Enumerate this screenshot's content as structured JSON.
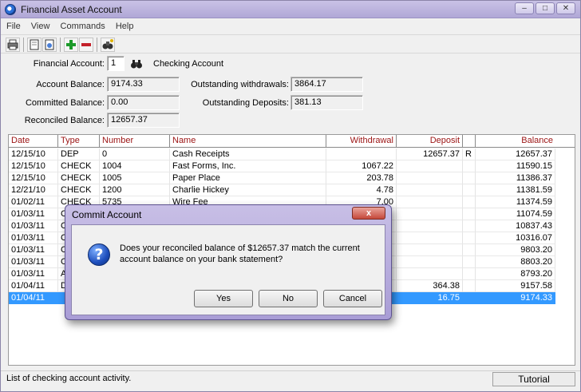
{
  "window": {
    "title": "Financial Asset Account"
  },
  "menu": [
    "File",
    "View",
    "Commands",
    "Help"
  ],
  "toolbar": {
    "icons": [
      "print-icon",
      "open-icon",
      "doc-icon",
      "add-icon",
      "remove-icon",
      "find-icon"
    ]
  },
  "account": {
    "financial_account_label": "Financial Account:",
    "financial_account_value": "1",
    "account_name": "Checking Account",
    "account_balance_label": "Account Balance:",
    "account_balance_value": "9174.33",
    "committed_balance_label": "Committed Balance:",
    "committed_balance_value": "0.00",
    "reconciled_balance_label": "Reconciled Balance:",
    "reconciled_balance_value": "12657.37",
    "outstanding_withdrawals_label": "Outstanding withdrawals:",
    "outstanding_withdrawals_value": "3864.17",
    "outstanding_deposits_label": "Outstanding Deposits:",
    "outstanding_deposits_value": "381.13"
  },
  "grid": {
    "columns": [
      "Date",
      "Type",
      "Number",
      "Name",
      "Withdrawal",
      "Deposit",
      "",
      "Balance"
    ],
    "rows": [
      [
        "12/15/10",
        "DEP",
        "0",
        "Cash Receipts",
        "",
        "12657.37",
        "R",
        "12657.37"
      ],
      [
        "12/15/10",
        "CHECK",
        "1004",
        "Fast Forms, Inc.",
        "1067.22",
        "",
        "",
        "11590.15"
      ],
      [
        "12/15/10",
        "CHECK",
        "1005",
        "Paper Place",
        "203.78",
        "",
        "",
        "11386.37"
      ],
      [
        "12/21/10",
        "CHECK",
        "1200",
        "Charlie Hickey",
        "4.78",
        "",
        "",
        "11381.59"
      ],
      [
        "01/02/11",
        "CHECK",
        "5735",
        "Wire Fee",
        "7.00",
        "",
        "",
        "11374.59"
      ],
      [
        "01/03/11",
        "C",
        "",
        "",
        "",
        "",
        "",
        "11074.59"
      ],
      [
        "01/03/11",
        "C",
        "",
        "",
        "",
        "",
        "",
        "10837.43"
      ],
      [
        "01/03/11",
        "C",
        "",
        "",
        "",
        "",
        "",
        "10316.07"
      ],
      [
        "01/03/11",
        "C",
        "",
        "",
        "",
        "",
        "",
        "9803.20"
      ],
      [
        "01/03/11",
        "C",
        "",
        "",
        "",
        "",
        "",
        "8803.20"
      ],
      [
        "01/03/11",
        "A",
        "",
        "",
        "",
        "",
        "",
        "8793.20"
      ],
      [
        "01/04/11",
        "D",
        "",
        "",
        "",
        "364.38",
        "",
        "9157.58"
      ],
      [
        "01/04/11",
        "",
        "",
        "",
        "",
        "16.75",
        "",
        "9174.33"
      ]
    ],
    "selected_row": 12
  },
  "dialog": {
    "title": "Commit Account",
    "close_glyph": "x",
    "message": "Does your reconciled balance of $12657.37 match the current account balance on your bank statement?",
    "yes_label": "Yes",
    "no_label": "No",
    "cancel_label": "Cancel"
  },
  "status": {
    "text": "List of checking account activity.",
    "tutorial_label": "Tutorial"
  }
}
